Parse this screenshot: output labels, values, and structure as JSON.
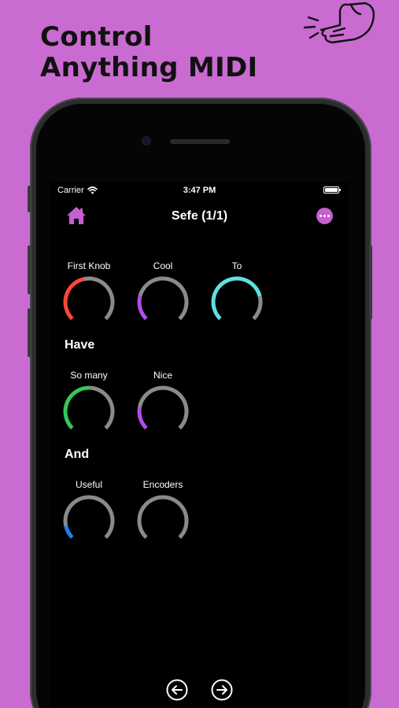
{
  "headline": {
    "line1": "Control",
    "line2": "Anything MIDI"
  },
  "status_bar": {
    "carrier": "Carrier",
    "time": "3:47 PM"
  },
  "nav": {
    "title": "Sefe (1/1)",
    "home_icon": "home-icon",
    "more_icon": "more-icon"
  },
  "colors": {
    "background": "#c96bd1",
    "accent": "#c65fd0",
    "knob_track": "#8a8a8a",
    "red": "#ff453a",
    "purple": "#b14ee6",
    "cyan": "#5ee0e0",
    "green": "#34c759",
    "blue": "#1e7ff0"
  },
  "sections": [
    {
      "title": ""
    },
    {
      "title": "Have"
    },
    {
      "title": "And"
    }
  ],
  "knobs": [
    {
      "label": "First Knob",
      "value": 0.45,
      "color": "#ff453a"
    },
    {
      "label": "Cool",
      "value": 0.22,
      "color": "#b14ee6"
    },
    {
      "label": "To",
      "value": 0.78,
      "color": "#5ee0e0"
    },
    {
      "label": "So many",
      "value": 0.5,
      "color": "#34c759"
    },
    {
      "label": "Nice",
      "value": 0.2,
      "color": "#b14ee6"
    },
    {
      "label": "Useful",
      "value": 0.12,
      "color": "#1e7ff0"
    },
    {
      "label": "Encoders",
      "value": 0,
      "color": "#8a8a8a"
    }
  ],
  "bottom_nav": {
    "prev_icon": "arrow-left-circle-icon",
    "next_icon": "arrow-right-circle-icon"
  }
}
